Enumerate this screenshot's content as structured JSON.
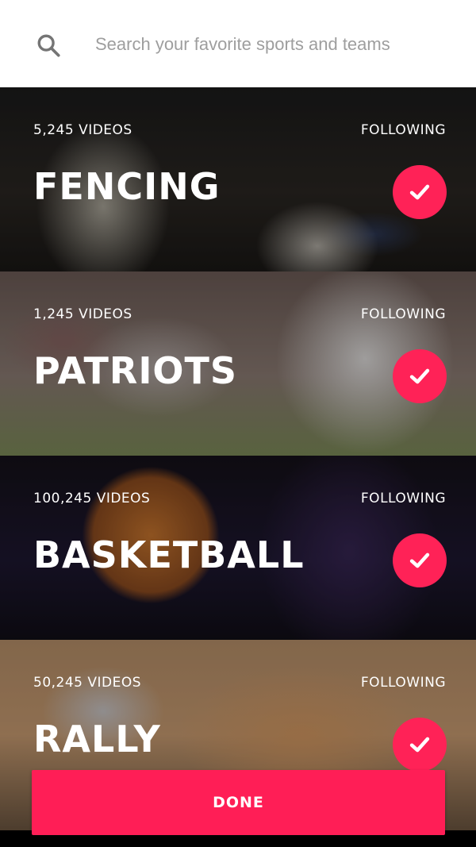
{
  "search": {
    "placeholder": "Search your favorite sports and teams",
    "icon": "search-icon"
  },
  "colors": {
    "accent": "#ff1e56",
    "search_background": "#ffffff",
    "placeholder_text": "#9e9e9e"
  },
  "topics": [
    {
      "name": "FENCING",
      "count": "5,245 VIDEOS",
      "status": "FOLLOWING",
      "followed": true,
      "icon": "check-icon"
    },
    {
      "name": "PATRIOTS",
      "count": "1,245 VIDEOS",
      "status": "FOLLOWING",
      "followed": true,
      "icon": "check-icon"
    },
    {
      "name": "BASKETBALL",
      "count": "100,245 VIDEOS",
      "status": "FOLLOWING",
      "followed": true,
      "icon": "check-icon"
    },
    {
      "name": "RALLY",
      "count": "50,245 VIDEOS",
      "status": "FOLLOWING",
      "followed": true,
      "icon": "check-icon"
    }
  ],
  "done_label": "DONE"
}
